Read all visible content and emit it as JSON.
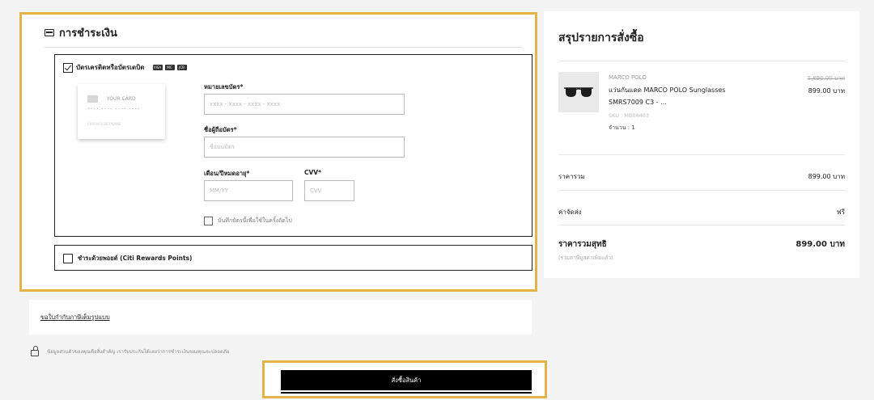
{
  "payment": {
    "title": "การชำระเงิน",
    "card_option": {
      "label": "บัตรเครดิตหรือบัตรเดบิต",
      "brands": [
        "VISA",
        "MC",
        "JCB"
      ]
    },
    "card_preview": {
      "label": "YOUR CARD",
      "number": "•••• •••• •••• ••••",
      "holder": "CARDHOLDER NAME"
    },
    "fields": {
      "card_number": {
        "label": "หมายเลขบัตร*",
        "placeholder": "xxxx - xxxx - xxxx - xxxx"
      },
      "card_name": {
        "label": "ชื่อผู้ถือบัตร*",
        "placeholder": "ชื่อบนบัตร"
      },
      "expiry": {
        "label": "เดือน/ปีหมดอายุ*",
        "placeholder": "MM/YY"
      },
      "cvv": {
        "label": "CVV*",
        "placeholder": "CVV"
      }
    },
    "remember_label": "บันทึกบัตรนี้เพื่อใช้ในครั้งถัดไป",
    "points_option": {
      "label": "ชำระด้วยพอยต์ (Citi Rewards Points)"
    }
  },
  "invoice_link": "ขอใบกำกับภาษีเต็มรูปแบบ",
  "secure_note": "ข้อมูลส่วนตัวของคุณคือสิ่งสำคัญ เรารับประกันได้เลยว่าการชำระเงินของคุณจะปลอดภัย",
  "order_button": "สั่งซื้อสินค้า",
  "summary": {
    "title": "สรุปรายการสั่งซื้อ",
    "item": {
      "brand": "MARCO POLO",
      "name": "แว่นกันแดด MARCO POLO Sunglasses SMRS7009 C3 - ...",
      "sku": "SKU : MB04403",
      "qty": "จำนวน : 1",
      "old_price": "5,890.00 บาท",
      "price": "899.00 บาท"
    },
    "subtotal_label": "ราคารวม",
    "subtotal_value": "899.00 บาท",
    "shipping_label": "ค่าจัดส่ง",
    "shipping_value": "ฟรี",
    "total_label": "ราคารวมสุทธิ",
    "total_value": "899.00 บาท",
    "vat_note": "(รวมภาษีมูลค่าเพิ่มแล้ว)"
  },
  "colors": {
    "highlight": "#e2b44a",
    "button": "#000000"
  }
}
